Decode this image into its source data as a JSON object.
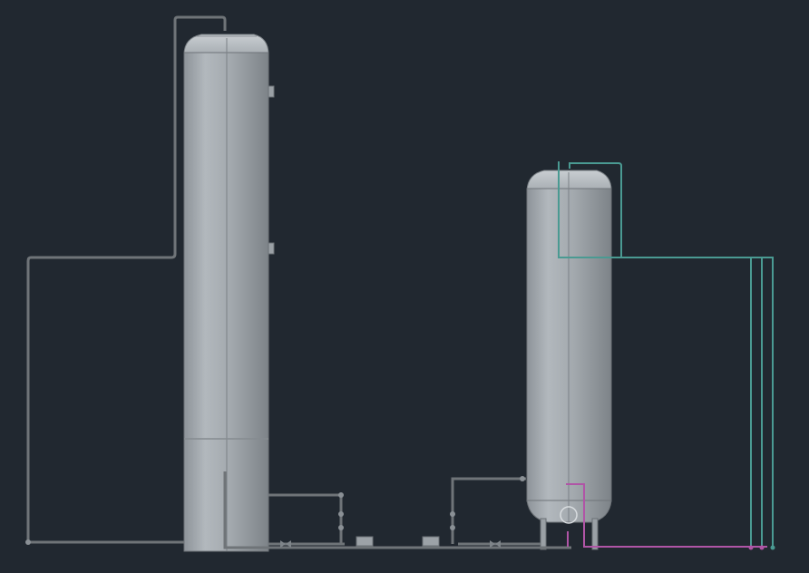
{
  "viewport": {
    "background": "#212830",
    "style": "shaded-3d-cad"
  },
  "equipment": [
    {
      "id": "tall-column-vessel",
      "kind": "vertical-vessel"
    },
    {
      "id": "short-receiver-vessel",
      "kind": "vertical-vessel"
    }
  ],
  "piping": {
    "process_color": "#6f7478",
    "teal_color": "#4a9a92",
    "magenta_color": "#b055a6"
  },
  "icons": [
    "valve-icon",
    "pump-icon",
    "nozzle-icon",
    "flange-icon"
  ]
}
